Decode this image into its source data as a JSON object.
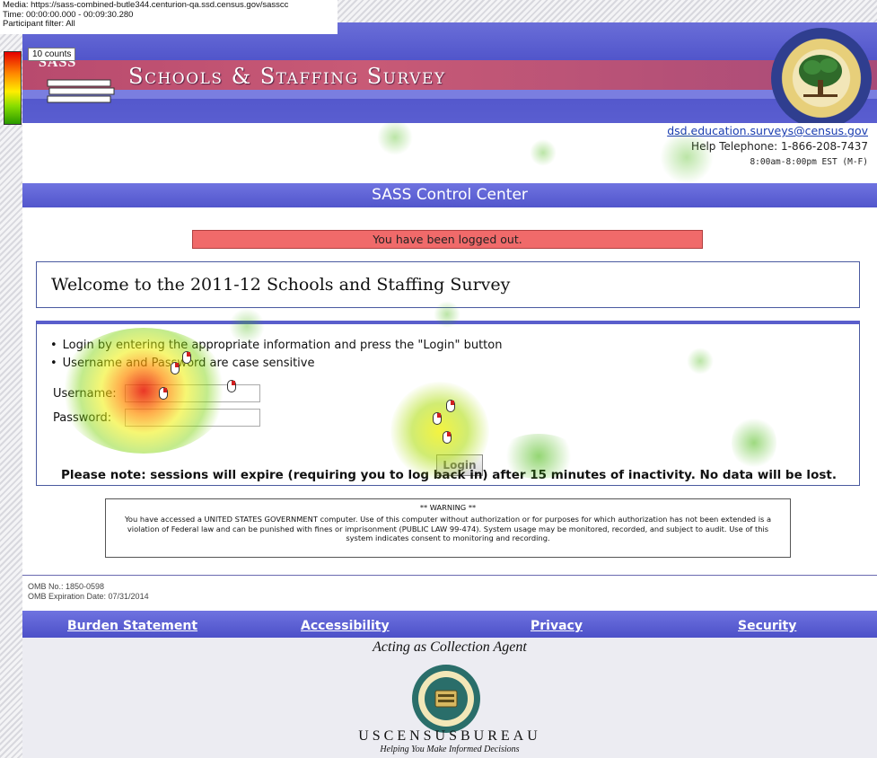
{
  "overlay": {
    "media": "Media: https://sass-combined-butle344.centurion-qa.ssd.census.gov/sasscc",
    "time": "Time: 00:00:00.000 - 00:09:30.280",
    "participant_filter": "Participant filter: All",
    "legend_count": "10 counts"
  },
  "header": {
    "logo_text": "SASS",
    "title": "Schools & Staffing Survey",
    "email": "dsd.education.surveys@census.gov",
    "phone": "Help Telephone: 1-866-208-7437",
    "hours": "8:00am-8:00pm EST (M-F)"
  },
  "control_center": {
    "title": "SASS Control Center"
  },
  "status": {
    "message": "You have been logged out."
  },
  "welcome": {
    "text": "Welcome to the 2011-12 Schools and Staffing Survey"
  },
  "login": {
    "instructions": [
      "Login by entering the appropriate information and press the \"Login\" button",
      "Username and Password are case sensitive"
    ],
    "username_label": "Username:",
    "password_label": "Password:",
    "username_value": "",
    "password_value": "",
    "button_label": "Login",
    "session_note": "Please note: sessions will expire (requiring you to log back in) after 15 minutes of inactivity. No data will be lost."
  },
  "warning": {
    "title": "** WARNING **",
    "body": "You have accessed a UNITED STATES GOVERNMENT computer. Use of this computer without authorization or for purposes for which authorization has not been extended is a violation of Federal law and can be punished with fines or imprisonment (PUBLIC LAW 99-474). System usage may be monitored, recorded, and subject to audit. Use of this system indicates consent to monitoring and recording."
  },
  "omb": {
    "number": "OMB No.: 1850-0598",
    "expiration": "OMB Expiration Date: 07/31/2014"
  },
  "footer_nav": {
    "burden": "Burden Statement",
    "accessibility": "Accessibility",
    "privacy": "Privacy",
    "security": "Security"
  },
  "footer": {
    "agent": "Acting as Collection Agent",
    "census_name": "USCENSUSBUREAU",
    "census_tagline": "Helping You Make Informed Decisions"
  },
  "colors": {
    "banner_blue": "#5a5ed0",
    "banner_stripe": "#b84a6e",
    "alert_red": "#f06a6a",
    "link_blue": "#1a3db0"
  }
}
